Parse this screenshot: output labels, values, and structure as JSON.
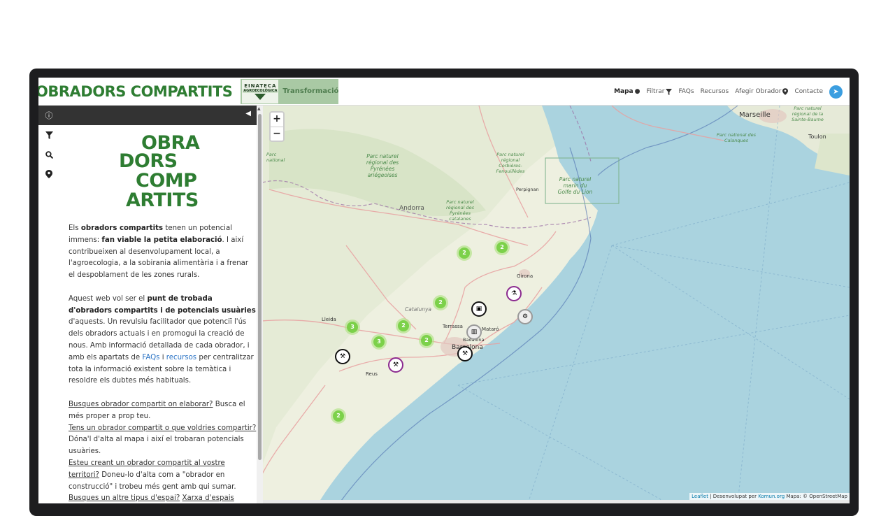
{
  "header": {
    "brand": "OBRADORS COMPARTITS",
    "partner_logo_line1": "EINATECA",
    "partner_logo_line2": "AGROECOLÒGICA",
    "partner_text": "Transformació",
    "nav": {
      "mapa": "Mapa",
      "filtrar": "Filtrar",
      "faqs": "FAQs",
      "recursos": "Recursos",
      "afegir": "Afegir Obrador",
      "contacte": "Contacte"
    }
  },
  "icons": {
    "info": "info-icon",
    "filter": "filter-icon",
    "search": "search-icon",
    "marker": "map-marker-icon",
    "telegram": "telegram-icon",
    "collapse": "chevron-left-icon"
  },
  "sidebar": {
    "logo_lines": [
      "OBRA",
      "DORS",
      "COMP",
      "ARTITS"
    ],
    "p1": {
      "a": "Els ",
      "b": "obradors compartits",
      "c": " tenen un potencial immens: ",
      "d": "fan viable la petita elaboració",
      "e": ". I així contribueixen al desenvolupament local, a l'agroecologia, a la sobirania alimentària i a frenar el despoblament de les zones rurals."
    },
    "p2": {
      "a": "Aquest web vol ser el ",
      "b": "punt de trobada d'obradors compartits i de potencials usuàries",
      "c": " d'aquests. Un revulsiu facilitador que potenciï l'ús dels obradors actuals i en promogui la creació de nous. Amb informació detallada de cada obrador, i amb els apartats de ",
      "link1": "FAQs",
      "d": " i ",
      "link2": "recursos",
      "e": " per centralitzar tota la informació existent sobre la temàtica i resoldre els dubtes més habituals."
    },
    "q1": "Busques obrador compartit on elaborar?",
    "q1_rest": " Busca el més proper a prop teu.",
    "q2": "Tens un obrador compartit o que voldries compartir?",
    "q2_rest": " Dóna'l d'alta al mapa i així el trobaran potencials usuàries.",
    "q3": "Esteu creant un obrador compartit al vostre territori?",
    "q3_rest": " Doneu-lo d'alta com a \"obrador en construcció\" i trobeu més gent amb qui sumar.",
    "q4": "Busques un altre tipus d'espai?",
    "q4_link": "Xarxa d'espais"
  },
  "map": {
    "zoom_in": "+",
    "zoom_out": "−",
    "clusters": [
      "2",
      "2",
      "2",
      "3",
      "2",
      "3",
      "2",
      "2"
    ],
    "labels": {
      "marseille": "Marseille",
      "toulon": "Toulon",
      "andorra": "Andorra",
      "girona": "Girona",
      "lleida": "Lleida",
      "terrassa": "Terrassa",
      "mataro": "Mataró",
      "badalona": "Badalona",
      "barcelona": "Barcelona",
      "reus": "Reus",
      "perpignan": "Perpignan",
      "catalunya": "Catalunya",
      "pyrenees": "Parc naturel régional des Pyrénées ariégeoises",
      "corbieres": "Parc naturel régional Corbières-Fenouillèdes",
      "catalanes": "Parc naturel régional des Pyrénées catalanes",
      "golfe": "Parc naturel marin du Golfe du Lion",
      "calanques": "Parc national des Calanques",
      "national": "Parc national",
      "sainte_baume": "Parc naturel régional de la Sainte-Baume"
    },
    "attribution": {
      "leaflet": "Leaflet",
      "dev": " | Desenvolupat per ",
      "komun": "Komun.org",
      "osm": " Mapa: © OpenStreetMap"
    }
  }
}
